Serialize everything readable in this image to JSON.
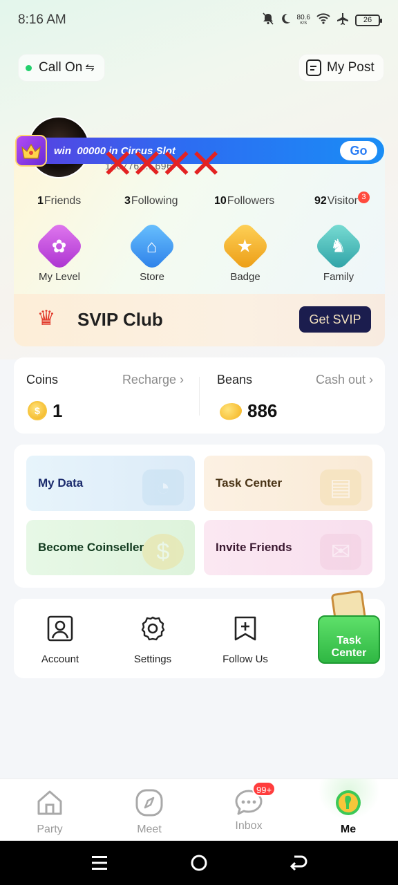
{
  "status_bar": {
    "time": "8:16 AM",
    "net_speed": "80.6",
    "net_unit": "K/S",
    "battery": "26",
    "icons": [
      "mute-icon",
      "moon-icon",
      "wifi-icon",
      "airplane-icon",
      "battery-icon"
    ]
  },
  "header": {
    "call_label": "Call On",
    "call_swap": "⇋",
    "post_label": "My Post"
  },
  "banner": {
    "text": "win ⁠ 00000 in Circus Slot",
    "go_label": "Go",
    "colors": {
      "start": "#5a3fe0",
      "end": "#1a8df5"
    }
  },
  "profile": {
    "user_id": "1207762…696",
    "stats": [
      {
        "value": "1",
        "label": "Friends"
      },
      {
        "value": "3",
        "label": "Following"
      },
      {
        "value": "10",
        "label": "Followers"
      },
      {
        "value": "92",
        "label": "Visitor",
        "badge": "3"
      }
    ]
  },
  "features": [
    {
      "label": "My Level",
      "icon": "level-icon",
      "color": "#c64ad9"
    },
    {
      "label": "Store",
      "icon": "store-icon",
      "color": "#3a8ff0"
    },
    {
      "label": "Badge",
      "icon": "badge-icon",
      "color": "#f1a91e"
    },
    {
      "label": "Family",
      "icon": "family-icon",
      "color": "#37b5ae"
    }
  ],
  "svip": {
    "title": "SVIP Club",
    "button": "Get SVIP"
  },
  "wallet": {
    "coins": {
      "label": "Coins",
      "link": "Recharge",
      "value": "1"
    },
    "beans": {
      "label": "Beans",
      "link": "Cash out",
      "value": "886"
    }
  },
  "tiles": [
    {
      "label": "My Data",
      "color": "#1a2a6c",
      "bg": "#e6f3fb"
    },
    {
      "label": "Task Center",
      "color": "#4a3416",
      "bg": "#fcf0e2"
    },
    {
      "label": "Become Coinseller",
      "color": "#123b1f",
      "bg": "#e5f7e5"
    },
    {
      "label": "Invite Friends",
      "color": "#3a1830",
      "bg": "#fbe6f1"
    }
  ],
  "actions": [
    {
      "label": "Account",
      "icon": "account-icon"
    },
    {
      "label": "Settings",
      "icon": "settings-icon"
    },
    {
      "label": "Follow Us",
      "icon": "follow-us-icon"
    }
  ],
  "task_promo": {
    "line1": "Task",
    "line2": "Center"
  },
  "tabbar": {
    "tabs": [
      {
        "label": "Party",
        "icon": "party-icon"
      },
      {
        "label": "Meet",
        "icon": "meet-icon"
      },
      {
        "label": "Inbox",
        "icon": "inbox-icon",
        "badge": "99+"
      },
      {
        "label": "Me",
        "icon": "me-icon",
        "active": true
      }
    ]
  }
}
